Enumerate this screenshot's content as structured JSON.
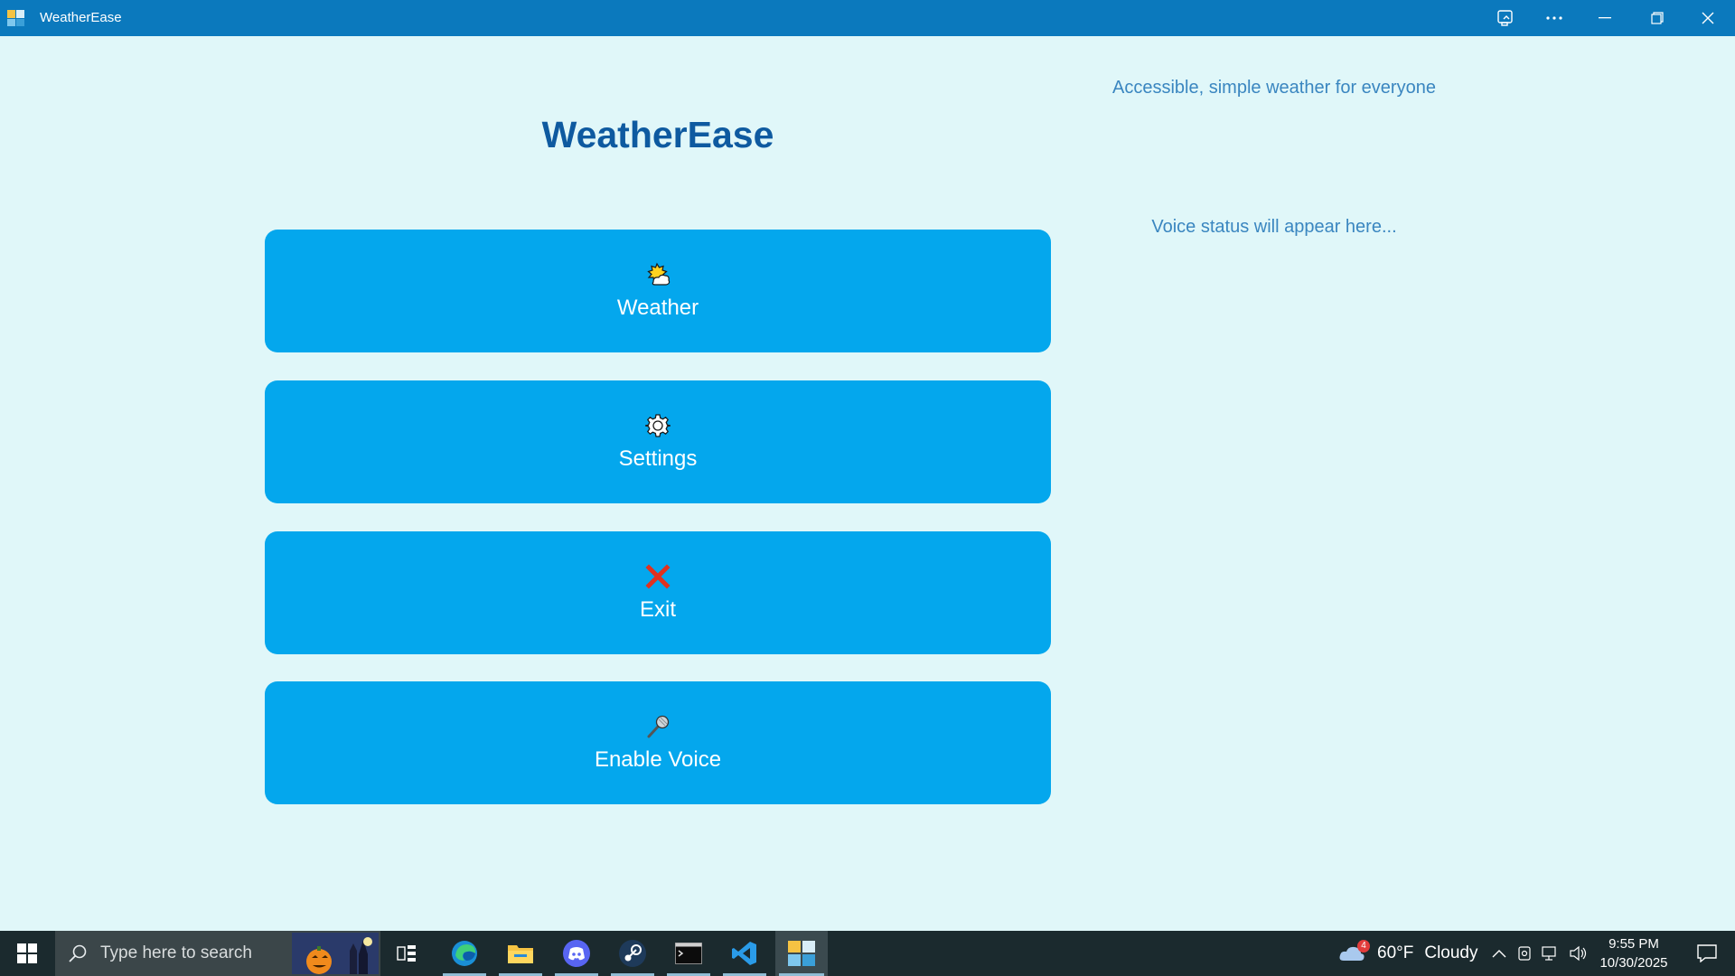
{
  "window": {
    "title": "WeatherEase",
    "controls": [
      "cast-icon",
      "more-icon",
      "minimize-icon",
      "restore-icon",
      "close-icon"
    ]
  },
  "main": {
    "heading": "WeatherEase",
    "tagline": "Accessible, simple weather for everyone",
    "voice_status": "Voice status will appear here...",
    "buttons": [
      {
        "label": "Weather",
        "icon": "sun-behind-cloud-icon"
      },
      {
        "label": "Settings",
        "icon": "gear-icon"
      },
      {
        "label": "Exit",
        "icon": "cross-mark-icon"
      },
      {
        "label": "Enable Voice",
        "icon": "microphone-icon"
      }
    ]
  },
  "taskbar": {
    "search_placeholder": "Type here to search",
    "apps": [
      "task-view-icon",
      "edge-icon",
      "file-explorer-icon",
      "discord-icon",
      "steam-icon",
      "terminal-icon",
      "vscode-icon",
      "weatherease-icon"
    ],
    "weather": {
      "temp": "60°F",
      "condition": "Cloudy",
      "badge": "4"
    },
    "time": "9:55 PM",
    "date": "10/30/2025"
  },
  "colors": {
    "titlebar": "#0b79bd",
    "background": "#e0f7f9",
    "button": "#04a7ed",
    "heading": "#0e5aa0",
    "status_text": "#3a86c0",
    "taskbar": "#1b2a2e"
  }
}
